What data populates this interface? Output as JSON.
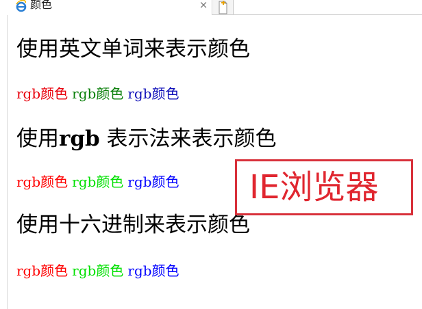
{
  "tab": {
    "title": "颜色",
    "favicon": "ie-icon",
    "close": "×"
  },
  "sections": [
    {
      "heading": "使用英文单词来表示颜色",
      "samples": [
        {
          "text": "rgb颜色",
          "color": "#e8000b"
        },
        {
          "text": "rgb颜色",
          "color": "#0a7f0a"
        },
        {
          "text": "rgb颜色",
          "color": "#0d0db8"
        }
      ]
    },
    {
      "heading_pre": "使用",
      "heading_bold": "rgb",
      "heading_post": " 表示法来表示颜色",
      "samples": [
        {
          "text": "rgb颜色",
          "color": "#ff0000"
        },
        {
          "text": "rgb颜色",
          "color": "#00e000"
        },
        {
          "text": "rgb颜色",
          "color": "#0000ff"
        }
      ]
    },
    {
      "heading": "使用十六进制来表示颜色",
      "samples": [
        {
          "text": "rgb颜色",
          "color": "#ff0000"
        },
        {
          "text": "rgb颜色",
          "color": "#00e000"
        },
        {
          "text": "rgb颜色",
          "color": "#0000ff"
        }
      ]
    }
  ],
  "annotation": {
    "text": "IE浏览器",
    "color": "#e0262f",
    "border_color": "#d8303a"
  }
}
